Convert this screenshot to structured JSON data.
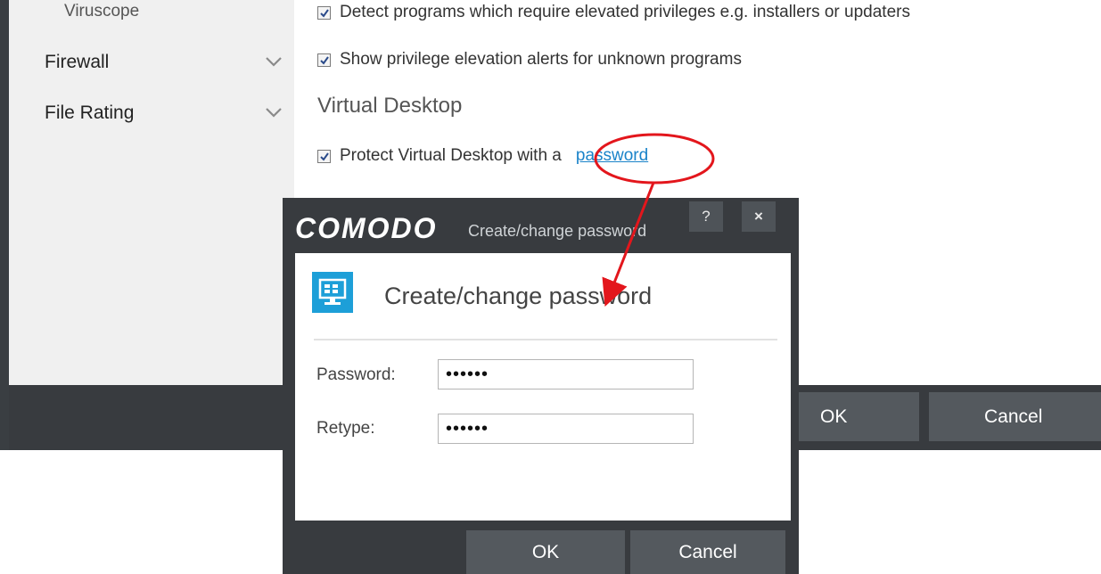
{
  "sidebar": {
    "items": [
      {
        "label": "Viruscope"
      },
      {
        "label": "Firewall",
        "icon": "chevron-down-icon"
      },
      {
        "label": "File Rating",
        "icon": "chevron-down-icon"
      }
    ]
  },
  "content": {
    "options": [
      {
        "label": "Detect programs which require elevated privileges e.g. installers or updaters",
        "checked": true
      },
      {
        "label": "Show privilege elevation alerts for unknown programs",
        "checked": true
      }
    ],
    "virtual_desktop": {
      "heading": "Virtual Desktop",
      "protect_label": "Protect Virtual Desktop with a",
      "link_text": "password",
      "checked": true
    }
  },
  "footer": {
    "ok_label": "OK",
    "cancel_label": "Cancel"
  },
  "dialog": {
    "brand": "COMODO",
    "caption": "Create/change password",
    "help_label": "?",
    "close_label": "×",
    "heading": "Create/change password",
    "password_label": "Password:",
    "password_value": "••••••",
    "retype_label": "Retype:",
    "retype_value": "••••••",
    "ok_label": "OK",
    "cancel_label": "Cancel"
  },
  "colors": {
    "dark_chrome": "#383b3f",
    "button": "#54595e",
    "link": "#1a83c9",
    "icon_accent": "#1d9fd8",
    "annotation": "#e3161c"
  }
}
